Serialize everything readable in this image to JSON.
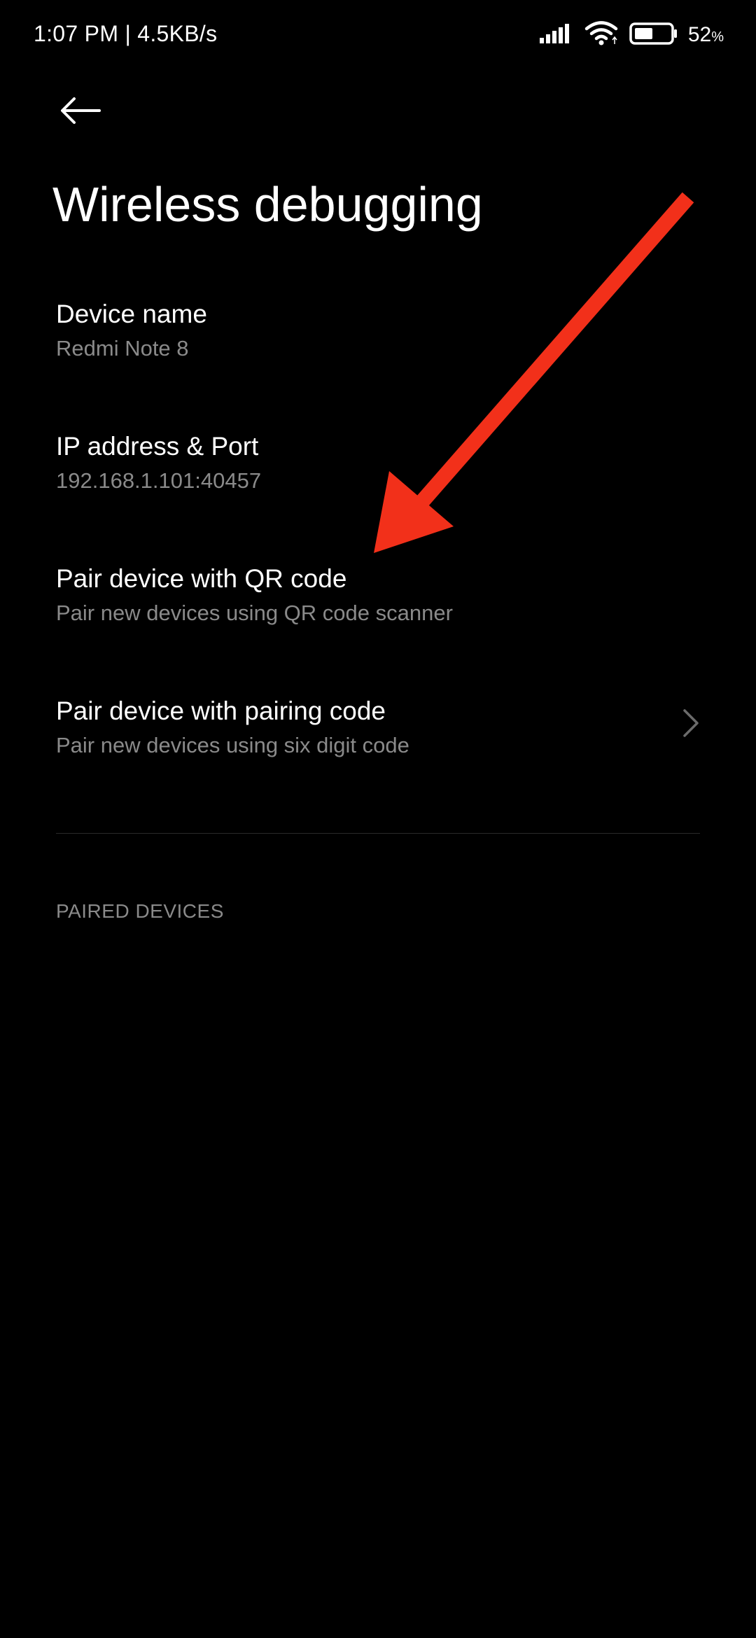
{
  "status_bar": {
    "time_speed": "1:07 PM | 4.5KB/s",
    "battery_percent": "52",
    "battery_unit": "%",
    "battery_level": 0.52,
    "icons": [
      "signal-icon",
      "wifi-icon",
      "battery-icon"
    ]
  },
  "header": {
    "back_icon": "back-arrow-icon",
    "title": "Wireless debugging"
  },
  "settings": [
    {
      "title": "Device name",
      "subtitle": "Redmi Note 8"
    },
    {
      "title": "IP address & Port",
      "subtitle": "192.168.1.101:40457"
    },
    {
      "title": "Pair device with QR code",
      "subtitle": "Pair new devices using QR code scanner"
    },
    {
      "title": "Pair device with pairing code",
      "subtitle": "Pair new devices using six digit code",
      "icon": "chevron-right-icon"
    }
  ],
  "sections": {
    "paired_devices_header": "PAIRED DEVICES"
  },
  "colors": {
    "background": "#000000",
    "primary_text": "#ffffff",
    "secondary_text": "#8a8a8a",
    "annotation_arrow": "#f2301a"
  },
  "annotation": {
    "icon": "red-arrow-annotation"
  }
}
